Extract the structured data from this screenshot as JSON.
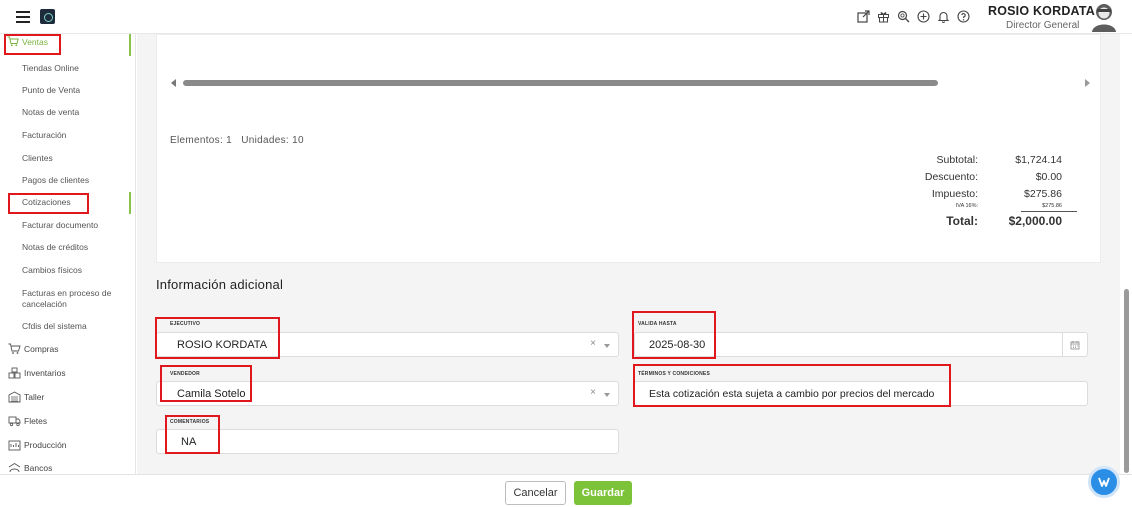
{
  "header": {
    "user_name": "ROSIO KORDATA",
    "user_role": "Director General",
    "icons": [
      "external-link-icon",
      "gift-icon",
      "search-icon",
      "add-circle-icon",
      "bell-icon",
      "help-icon"
    ]
  },
  "sidebar": {
    "ventas_label": "Ventas",
    "sub_items": [
      "Tiendas Online",
      "Punto de Venta",
      "Notas de venta",
      "Facturación",
      "Clientes",
      "Pagos de clientes",
      "Cotizaciones",
      "Facturar documento",
      "Notas de créditos",
      "Cambios físicos",
      "Facturas en proceso de",
      "cancelación",
      "Cfdis del sistema"
    ],
    "main_items": [
      "Compras",
      "Inventarios",
      "Taller",
      "Fletes",
      "Producción",
      "Bancos"
    ]
  },
  "summary": {
    "elements_label": "Elementos:",
    "elements_value": "1",
    "units_label": "Unidades:",
    "units_value": "10"
  },
  "totals": {
    "subtotal_label": "Subtotal:",
    "subtotal_value": "$1,724.14",
    "discount_label": "Descuento:",
    "discount_value": "$0.00",
    "tax_label": "Impuesto:",
    "tax_value": "$275.86",
    "iva_label": "IVA 16%:",
    "iva_value": "$275.86",
    "total_label": "Total:",
    "total_value": "$2,000.00"
  },
  "additional_info": {
    "title": "Información adicional",
    "ejecutivo_label": "EJECUTIVO",
    "ejecutivo_value": "ROSIO KORDATA",
    "valida_label": "VALIDA HASTA",
    "valida_value": "2025-08-30",
    "vendedor_label": "VENDEDOR",
    "vendedor_value": "Camila Sotelo",
    "terminos_label": "TÉRMINOS Y CONDICIONES",
    "terminos_value": "Esta cotización esta sujeta a cambio por precios del mercado",
    "comentarios_label": "COMENTARIOS",
    "comentarios_value": "NA",
    "clear_symbol": "×"
  },
  "footer": {
    "cancel_label": "Cancelar",
    "save_label": "Guardar"
  },
  "colors": {
    "accent_green": "#7cc33a",
    "highlight_red": "#e0181e",
    "chat_blue": "#2b8ee6"
  }
}
